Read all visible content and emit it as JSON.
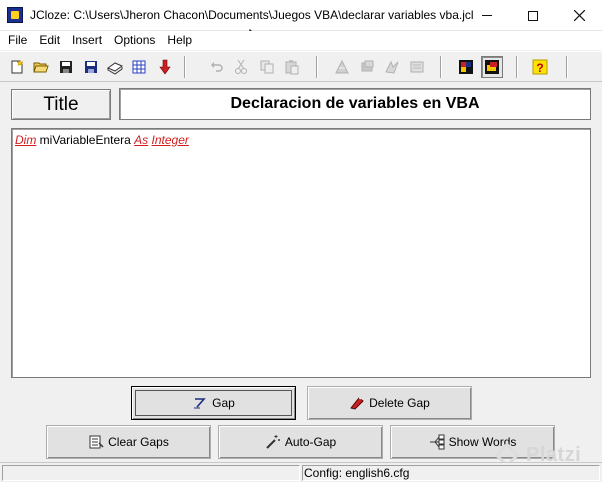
{
  "window": {
    "title": "JCloze: C:\\Users\\Jheron Chacon\\Documents\\Juegos VBA\\declarar variables vba.jcl"
  },
  "menu": {
    "items": [
      {
        "label": "File"
      },
      {
        "label": "Edit"
      },
      {
        "label": "Insert"
      },
      {
        "label": "Options"
      },
      {
        "label": "Help"
      }
    ]
  },
  "toolbar": {
    "icons": [
      "new-file-icon",
      "open-folder-icon",
      "save-icon",
      "save-as-icon",
      "book-icon",
      "web-page-icon",
      "export-arrow-icon",
      "undo-icon",
      "cut-icon",
      "copy-icon",
      "paste-icon",
      "gap-tool-1-icon",
      "gap-tool-2-icon",
      "gap-tool-3-icon",
      "gap-tool-4-icon",
      "palette-icon",
      "config-icon",
      "help-icon"
    ]
  },
  "title_label": "Title",
  "title_value": "Declaracion de variables en VBA",
  "editor": {
    "tokens": [
      {
        "text": "Dim",
        "gap": true
      },
      {
        "text": " ",
        "gap": false
      },
      {
        "text": "miVariableEntera",
        "gap": false
      },
      {
        "text": " ",
        "gap": false
      },
      {
        "text": "As",
        "gap": true
      },
      {
        "text": " ",
        "gap": false
      },
      {
        "text": "Integer",
        "gap": true
      }
    ]
  },
  "buttons": {
    "gap": "Gap",
    "delete_gap": "Delete Gap",
    "clear_gaps": "Clear Gaps",
    "auto_gap": "Auto-Gap",
    "show_words": "Show Words"
  },
  "status": {
    "config": "Config: english6.cfg"
  },
  "watermark": "Platzi",
  "colors": {
    "gap_text": "#d21e1e",
    "background": "#f0f0f0"
  }
}
